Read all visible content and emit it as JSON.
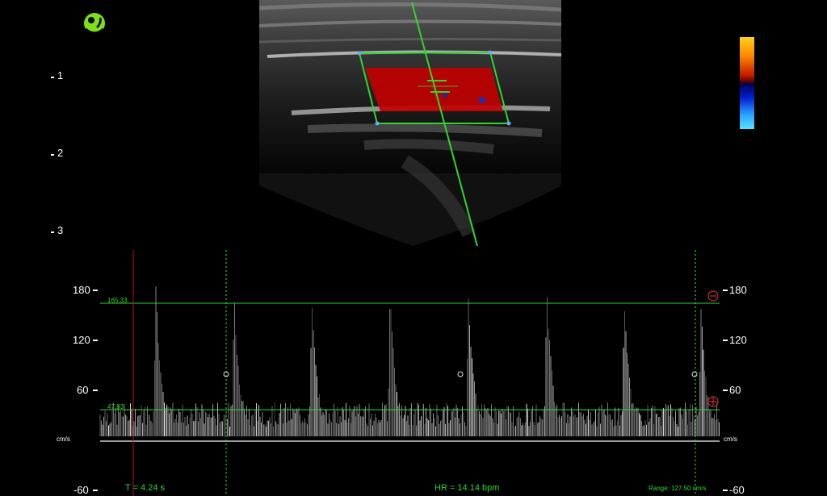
{
  "depth_scale": {
    "labels": [
      "1",
      "2",
      "3"
    ]
  },
  "doppler": {
    "left_axis": [
      "180",
      "120",
      "60",
      "-60"
    ],
    "right_axis": [
      "180",
      "120",
      "60",
      "-60"
    ],
    "unit_left": "cm/s",
    "unit_right": "cm/s",
    "upper_cursor_value": "165.33",
    "lower_cursor_value": "47.83",
    "time": "T = 4.24 s",
    "heart_rate": "HR = 14.14 bpm",
    "range": "Range: 127.50 cm/s",
    "peak_count": 8
  },
  "colors": {
    "accent": "#2fd62f",
    "time_marker": "#b01818",
    "flow_box_fill": "#c00000",
    "logo": "#7de01a"
  },
  "icons": {
    "logo": "probe-logo-icon",
    "upper_cursor": "minus-circle-icon",
    "lower_cursor": "crosshair-circle-icon"
  }
}
